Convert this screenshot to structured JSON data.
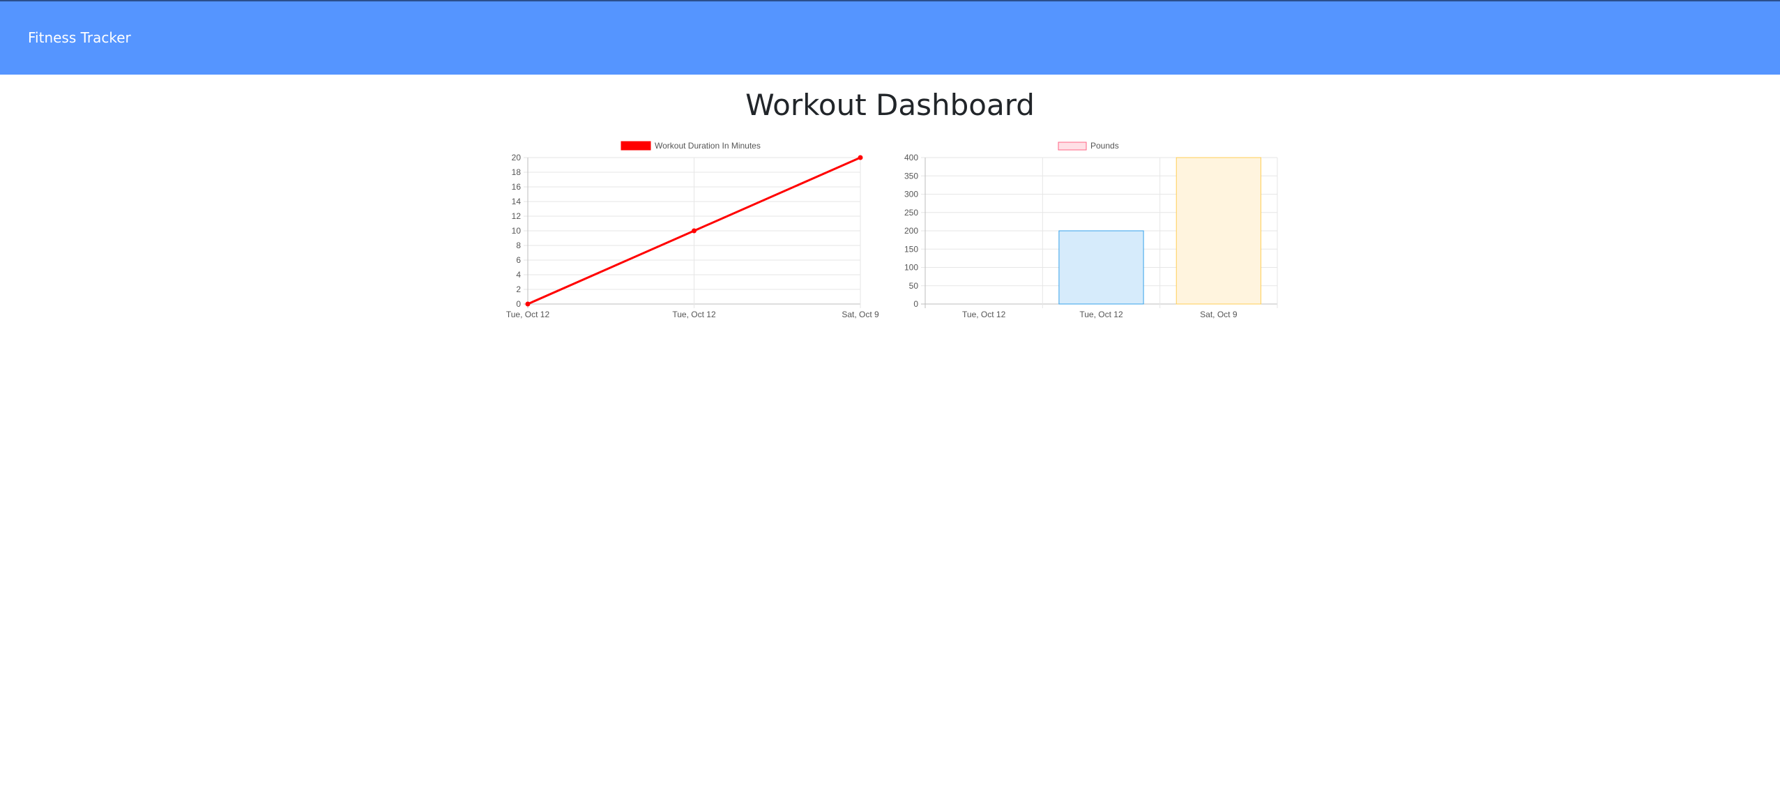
{
  "navbar": {
    "brand": "Fitness Tracker"
  },
  "page": {
    "title": "Workout Dashboard"
  },
  "chart_data": [
    {
      "type": "line",
      "categories": [
        "Tue, Oct 12",
        "Tue, Oct 12",
        "Sat, Oct 9"
      ],
      "series": [
        {
          "name": "Workout Duration In Minutes",
          "values": [
            0,
            10,
            20
          ],
          "color": "#ff0000"
        }
      ],
      "yticks": [
        0,
        2,
        4,
        6,
        8,
        10,
        12,
        14,
        16,
        18,
        20
      ],
      "ylim": [
        0,
        20
      ],
      "grid": true,
      "legend": "top-center"
    },
    {
      "type": "bar",
      "categories": [
        "Tue, Oct 12",
        "Tue, Oct 12",
        "Sat, Oct 9"
      ],
      "series": [
        {
          "name": "Pounds",
          "values": [
            0,
            200,
            400
          ],
          "fill_colors": [
            "#ffe0e6",
            "#d6ebfb",
            "#fff4de"
          ],
          "border_colors": [
            "#ff6384",
            "#36a2eb",
            "#ffce56"
          ],
          "legend_fill": "#ffe0e6",
          "legend_border": "#ff6384"
        }
      ],
      "yticks": [
        0,
        50,
        100,
        150,
        200,
        250,
        300,
        350,
        400
      ],
      "ylim": [
        0,
        400
      ],
      "grid": true,
      "legend": "top-center"
    }
  ]
}
